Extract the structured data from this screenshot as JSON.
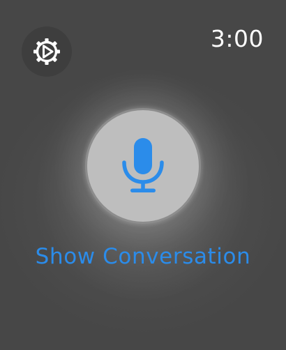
{
  "status_bar": {
    "time": "3:00"
  },
  "settings": {
    "icon": "settings-gear-play-icon"
  },
  "mic": {
    "icon": "microphone-icon",
    "color": "#2b8cea"
  },
  "show_conversation_label": "Show Conversation",
  "colors": {
    "background": "#4a4a4a",
    "accent": "#2b8cea",
    "mic_button": "#bebebe"
  }
}
